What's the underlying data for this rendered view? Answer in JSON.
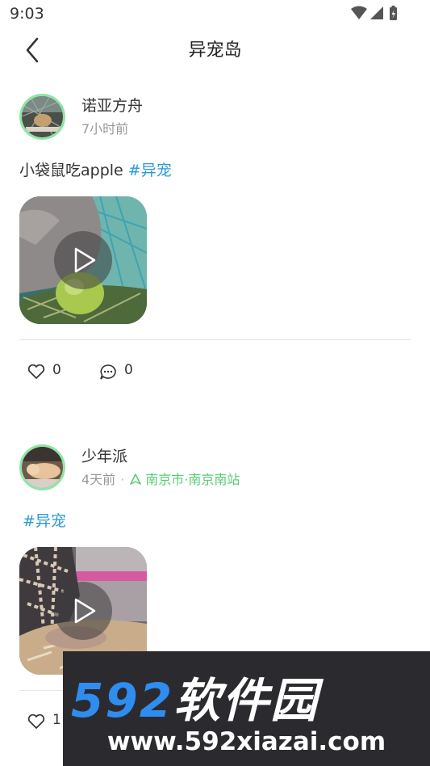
{
  "status_bar": {
    "time": "9:03"
  },
  "nav": {
    "title": "异宠岛"
  },
  "posts": [
    {
      "username": "诺亚方舟",
      "time": "7小时前",
      "text": "小袋鼠吃apple ",
      "hashtag": "#异宠",
      "likes": "0",
      "comments": "0"
    },
    {
      "username": "少年派",
      "time": "4天前",
      "location": "南京市·南京南站",
      "hashtag": "#异宠",
      "likes": "1"
    }
  ],
  "watermark": {
    "brand_num": "592",
    "brand_cn": "软件园",
    "url": "www.592xiazai.com"
  },
  "colors": {
    "hashtag": "#2b9bd6",
    "location": "#58cc74",
    "avatar_ring": "#8ee6a4"
  }
}
